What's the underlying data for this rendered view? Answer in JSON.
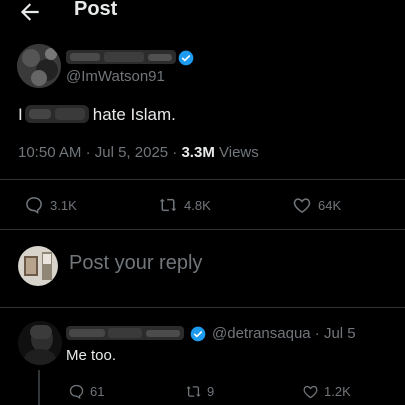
{
  "header": {
    "title": "Post",
    "back_icon": "arrow-left-icon"
  },
  "post": {
    "display_name_censored": true,
    "verified_color": "#1d9bf0",
    "handle": "@ImWatson91",
    "text_prefix": "I",
    "text_suffix": "hate Islam.",
    "time": "10:50 AM",
    "date": "Jul 5, 2025",
    "views_count": "3.3M",
    "views_label": "Views",
    "separator": "·"
  },
  "actions": {
    "replies": "3.1K",
    "reposts": "4.8K",
    "likes": "64K"
  },
  "composer": {
    "placeholder": "Post your reply"
  },
  "reply": {
    "display_name_censored": true,
    "handle_and_date": "@detransaqua · Jul 5",
    "text": "Me too.",
    "replies": "61",
    "reposts": "9",
    "likes": "1.2K"
  },
  "colors": {
    "background": "#000000",
    "text": "#e7e9ea",
    "muted": "#71767b",
    "divider": "#2f3336",
    "accent": "#1d9bf0"
  }
}
